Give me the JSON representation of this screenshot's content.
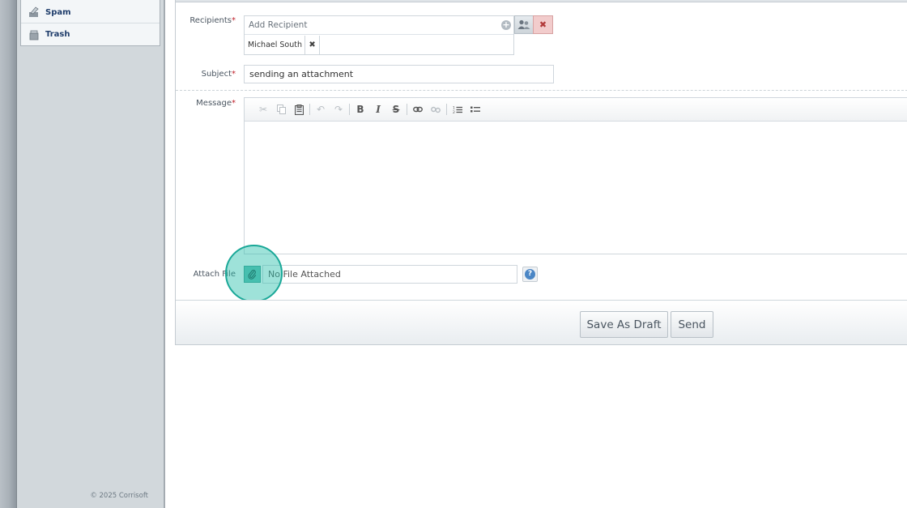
{
  "sidebar": {
    "folders": [
      {
        "label": "Spam",
        "icon": "spam-icon"
      },
      {
        "label": "Trash",
        "icon": "trash-icon"
      }
    ],
    "copyright": "© 2025 Corrisoft"
  },
  "compose": {
    "recipients_label": "Recipients",
    "recipient_placeholder": "Add Recipient",
    "recipients": [
      "Michael South"
    ],
    "subject_label": "Subject",
    "subject_value": "sending an attachment",
    "message_label": "Message",
    "required_marker": "*",
    "attach_label": "Attach File",
    "attach_status": "No File Attached",
    "help_glyph": "?"
  },
  "toolbar": {
    "buttons": [
      {
        "name": "cut-icon",
        "enabled": false
      },
      {
        "name": "copy-icon",
        "enabled": false
      },
      {
        "name": "paste-icon",
        "enabled": true
      },
      {
        "name": "undo-icon",
        "enabled": false
      },
      {
        "name": "redo-icon",
        "enabled": false
      },
      {
        "name": "bold-icon",
        "enabled": true
      },
      {
        "name": "italic-icon",
        "enabled": true
      },
      {
        "name": "strikethrough-icon",
        "enabled": true
      },
      {
        "name": "link-icon",
        "enabled": true
      },
      {
        "name": "unlink-icon",
        "enabled": false
      },
      {
        "name": "numbered-list-icon",
        "enabled": true
      },
      {
        "name": "bulleted-list-icon",
        "enabled": true
      }
    ]
  },
  "actions": {
    "save_draft": "Save As Draft",
    "send": "Send"
  },
  "colors": {
    "required": "#c0202a",
    "highlight": "#1aa898",
    "folder_text": "#1f3d6b"
  }
}
